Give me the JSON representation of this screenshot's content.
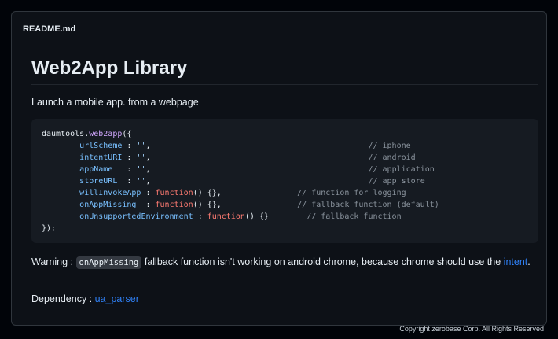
{
  "file_header": {
    "name": "README.md"
  },
  "readme": {
    "title": "Web2App Library",
    "description": "Launch a mobile app. from a webpage",
    "code": {
      "line1": {
        "obj": "daumtools",
        "dot": ".",
        "method": "web2app",
        "open": "({"
      },
      "props": [
        {
          "indent": "        ",
          "key": "urlScheme",
          "sep": " : ",
          "value": "''",
          "end": ",",
          "pad": "                                              ",
          "comment": "// iphone"
        },
        {
          "indent": "        ",
          "key": "intentURI",
          "sep": " : ",
          "value": "''",
          "end": ",",
          "pad": "                                              ",
          "comment": "// android"
        },
        {
          "indent": "        ",
          "key": "appName",
          "sep": "   : ",
          "value": "''",
          "end": ",",
          "pad": "                                              ",
          "comment": "// application"
        },
        {
          "indent": "        ",
          "key": "storeURL",
          "sep": "  : ",
          "value": "''",
          "end": ",",
          "pad": "                                              ",
          "comment": "// app store"
        }
      ],
      "funcs": [
        {
          "indent": "        ",
          "key": "willInvokeApp",
          "sep": " : ",
          "kw": "function",
          "rest": "() {},",
          "pad": "                ",
          "comment": "// function for logging"
        },
        {
          "indent": "        ",
          "key": "onAppMissing",
          "sep": "  : ",
          "kw": "function",
          "rest": "() {},",
          "pad": "                ",
          "comment": "// fallback function (default)"
        },
        {
          "indent": "        ",
          "key": "onUnsupportedEnvironment",
          "sep": " : ",
          "kw": "function",
          "rest": "() {}",
          "pad": "        ",
          "comment": "// fallback function"
        }
      ],
      "close": "});"
    },
    "warning": {
      "label": "Warning : ",
      "code": "onAppMissing",
      "text": " fallback function isn't working on android chrome, because chrome should use the ",
      "link": "intent",
      "end": "."
    },
    "dependency": {
      "label": "Dependency : ",
      "link": "ua_parser"
    }
  },
  "footer": {
    "copyright": "Copyright zerobase Corp. All Rights Reserved"
  },
  "colors": {
    "background": "#0d1117",
    "code_background": "#161b22",
    "link": "#2f81f7",
    "string": "#a5d6ff",
    "keyword": "#ff7b72",
    "property": "#79c0ff",
    "function_name": "#d2a8ff",
    "comment": "#8b949e"
  }
}
